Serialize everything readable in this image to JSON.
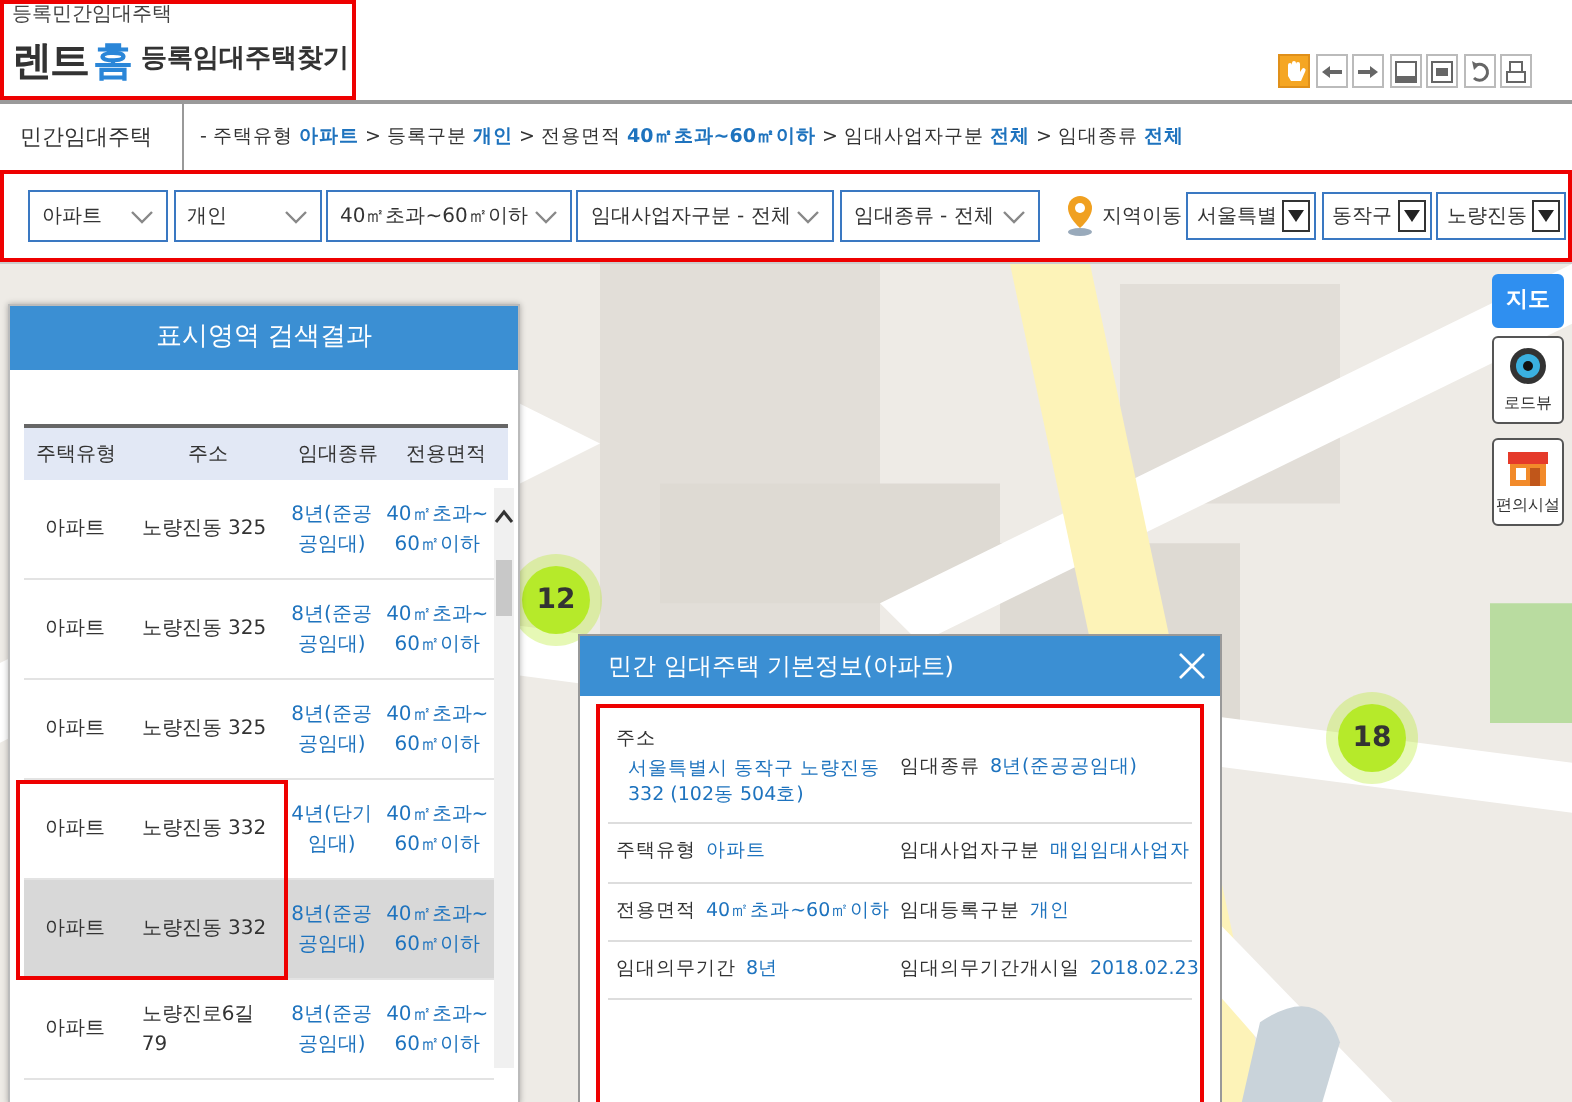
{
  "header": {
    "logo": {
      "tagline": "등록민간임대주택",
      "mark": [
        {
          "text": "렌트",
          "color": "#333333"
        },
        {
          "text": "홈",
          "color": "#2a86d8"
        }
      ],
      "title": "등록임대주택찾기",
      "highlighted": true
    },
    "toolbar": [
      {
        "kind": "hand",
        "selected": true
      },
      {
        "kind": "back",
        "selected": false
      },
      {
        "kind": "forward",
        "selected": false
      },
      {
        "kind": "panel-bottom",
        "selected": false
      },
      {
        "kind": "panel-middle",
        "selected": false
      },
      {
        "kind": "undo",
        "selected": false
      },
      {
        "kind": "print",
        "selected": false
      }
    ]
  },
  "section": {
    "title": "민간임대주택",
    "breadcrumb": "- 주택유형 **아파트** > 등록구분 **개인** > 전용면적 **40㎡초과~60㎡이하** > 임대사업자구분 **전체** > 임대종류 **전체**"
  },
  "filters": {
    "highlighted": true,
    "dropdowns": [
      "아파트",
      "개인",
      "40㎡초과~60㎡이하",
      "임대사업자구분 - 전체",
      "임대종류 - 전체"
    ],
    "region_label": "지역이동",
    "region_dropdowns": [
      "서울특별",
      "동작구",
      "노량진동"
    ]
  },
  "results": {
    "title": "표시영역 검색결과",
    "columns": [
      "주택유형",
      "주소",
      "임대종류",
      "전용면적"
    ],
    "rows": [
      {
        "cells": [
          "아파트",
          "노량진동 325",
          "8년(준공공임대)",
          "40㎡초과~60㎡이하"
        ],
        "selected": false,
        "highlighted": false
      },
      {
        "cells": [
          "아파트",
          "노량진동 325",
          "8년(준공공임대)",
          "40㎡초과~60㎡이하"
        ],
        "selected": false,
        "highlighted": false
      },
      {
        "cells": [
          "아파트",
          "노량진동 325",
          "8년(준공공임대)",
          "40㎡초과~60㎡이하"
        ],
        "selected": false,
        "highlighted": false
      },
      {
        "cells": [
          "아파트",
          "노량진동 332",
          "4년(단기임대)",
          "40㎡초과~60㎡이하"
        ],
        "selected": false,
        "highlighted": true
      },
      {
        "cells": [
          "아파트",
          "노량진동 332",
          "8년(준공공임대)",
          "40㎡초과~60㎡이하"
        ],
        "selected": true,
        "highlighted": true
      },
      {
        "cells": [
          "아파트",
          "노량진로6길 79",
          "8년(준공공임대)",
          "40㎡초과~60㎡이하"
        ],
        "selected": false,
        "highlighted": false
      }
    ]
  },
  "map": {
    "clusters": [
      "12",
      "18"
    ],
    "controls": [
      {
        "kind": "map",
        "label": "지도",
        "selected": true
      },
      {
        "kind": "roadview",
        "label": "로드뷰",
        "selected": false
      },
      {
        "kind": "facilities",
        "label": "편의시설",
        "selected": false
      }
    ]
  },
  "popup": {
    "title": "민간 임대주택 기본정보(아파트)",
    "highlighted": true,
    "rows": [
      [
        {
          "label": "주소",
          "value": "서울특별시 동작구 노량진동 332 (102동 504호)",
          "kind": "stacked"
        },
        {
          "label": "임대종류",
          "value": "8년(준공공임대)",
          "kind": "inline"
        }
      ],
      [
        {
          "label": "주택유형",
          "value": "아파트",
          "kind": "inline"
        },
        {
          "label": "임대사업자구분",
          "value": "매입임대사업자",
          "kind": "inline"
        }
      ],
      [
        {
          "label": "전용면적",
          "value": "40㎡초과~60㎡이하",
          "kind": "inline"
        },
        {
          "label": "임대등록구분",
          "value": "개인",
          "kind": "inline"
        }
      ],
      [
        {
          "label": "임대의무기간",
          "value": "8년",
          "kind": "inline"
        },
        {
          "label": "임대의무기간개시일",
          "value": "2018.02.23",
          "kind": "inline"
        }
      ]
    ]
  }
}
